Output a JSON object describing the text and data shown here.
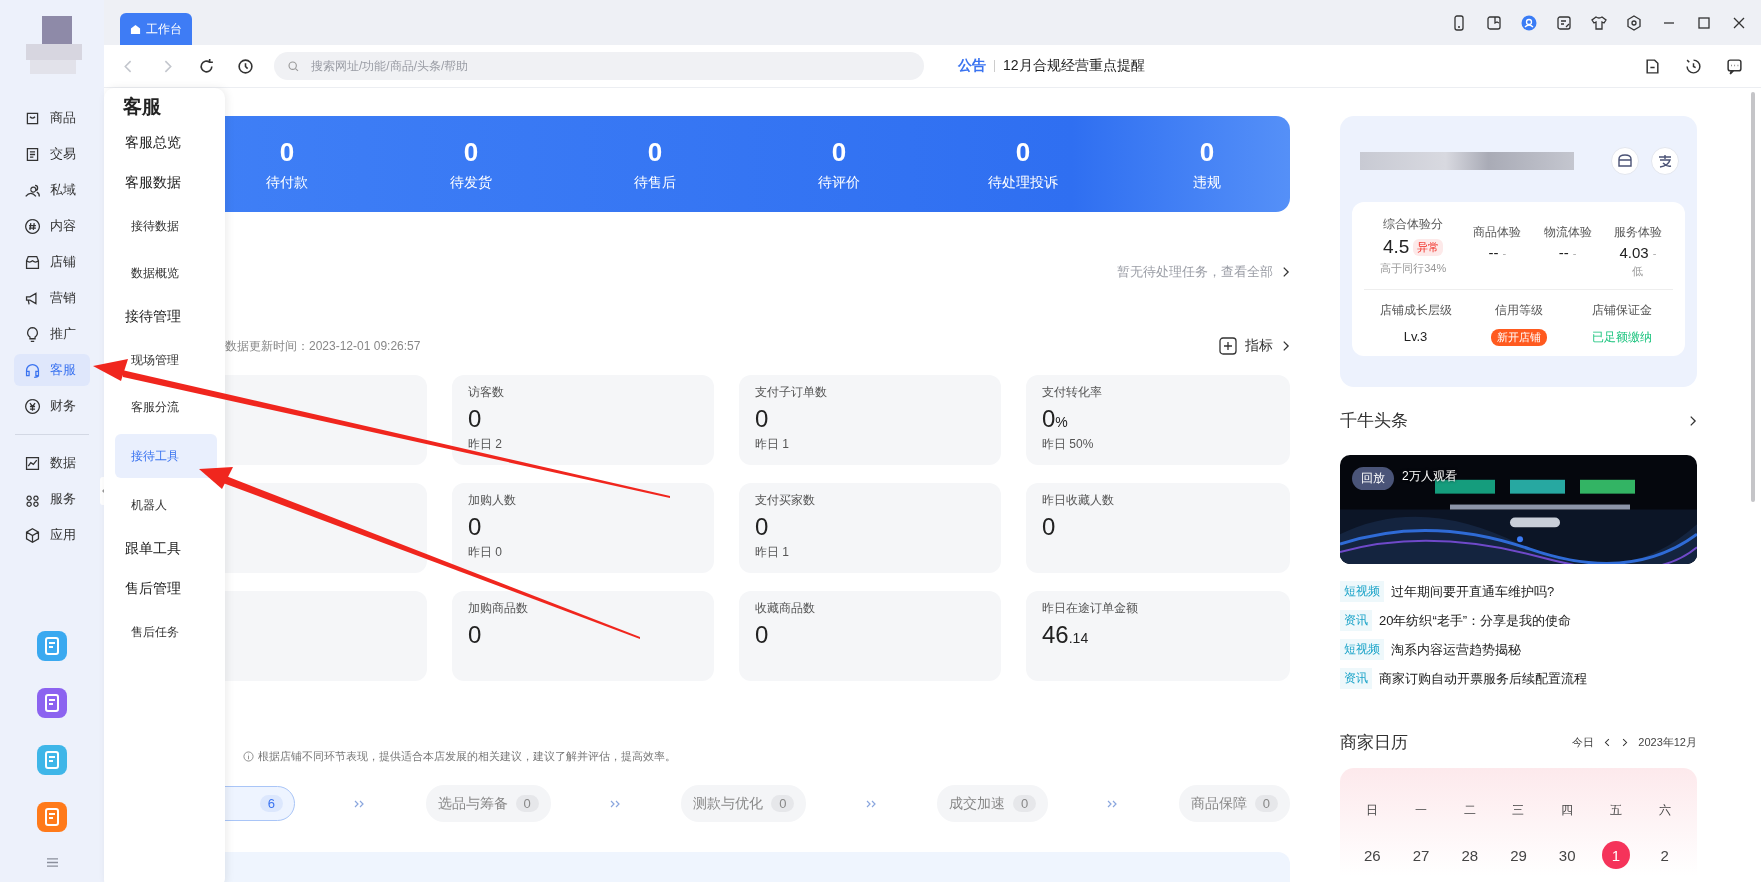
{
  "nav": [
    {
      "label": "商品",
      "selected": false
    },
    {
      "label": "交易",
      "selected": false
    },
    {
      "label": "私域",
      "selected": false
    },
    {
      "label": "内容",
      "selected": false
    },
    {
      "label": "店铺",
      "selected": false
    },
    {
      "label": "营销",
      "selected": false
    },
    {
      "label": "推广",
      "selected": false
    },
    {
      "label": "客服",
      "selected": true
    },
    {
      "label": "财务",
      "selected": false
    }
  ],
  "nav_extra": [
    {
      "label": "数据",
      "selected": false
    },
    {
      "label": "服务",
      "selected": false
    },
    {
      "label": "应用",
      "selected": false
    }
  ],
  "tab": {
    "label": "工作台",
    "selected": true
  },
  "search": {
    "placeholder": "搜索网址/功能/商品/头条/帮助"
  },
  "notice": {
    "tag": "公告",
    "text": "12月合规经营重点提醒"
  },
  "flyout": {
    "title": "客服",
    "items": [
      {
        "label": "客服总览",
        "selected": false
      },
      {
        "label": "客服数据",
        "selected": false,
        "children": [
          {
            "label": "接待数据",
            "selected": false
          },
          {
            "label": "数据概览",
            "selected": false
          }
        ]
      },
      {
        "label": "接待管理",
        "selected": false,
        "children": [
          {
            "label": "现场管理",
            "selected": false
          },
          {
            "label": "客服分流",
            "selected": false
          },
          {
            "label": "接待工具",
            "selected": true
          },
          {
            "label": "机器人",
            "selected": false
          }
        ]
      },
      {
        "label": "跟单工具",
        "selected": false
      },
      {
        "label": "售后管理",
        "selected": false,
        "children": [
          {
            "label": "售后任务",
            "selected": false
          }
        ]
      }
    ]
  },
  "order_stats": [
    {
      "value": "0",
      "label": "待付款"
    },
    {
      "value": "0",
      "label": "待发货"
    },
    {
      "value": "0",
      "label": "待售后"
    },
    {
      "value": "0",
      "label": "待评价"
    },
    {
      "value": "0",
      "label": "待处理投诉"
    },
    {
      "value": "0",
      "label": "违规"
    }
  ],
  "pending": "暂无待处理任务，查看全部",
  "data": {
    "updated": "数据更新时间：2023-12-01 09:26:57",
    "metrics_link": "指标",
    "rows": [
      [
        {
          "label": "访客数",
          "value": "0",
          "prev": "昨日 2"
        },
        {
          "label": "支付子订单数",
          "value": "0",
          "prev": "昨日 1"
        },
        {
          "label": "支付转化率",
          "value": "0",
          "unit": "%",
          "prev": "昨日 50%"
        }
      ],
      [
        {
          "label": "加购人数",
          "value": "0",
          "prev": "昨日 0"
        },
        {
          "label": "支付买家数",
          "value": "0",
          "prev": "昨日 1"
        },
        {
          "label": "昨日收藏人数",
          "value": "0"
        }
      ],
      [
        {
          "label": "加购商品数",
          "value": "0"
        },
        {
          "label": "收藏商品数",
          "value": "0"
        },
        {
          "label": "昨日在途订单金额",
          "value": "46",
          "unit": ".14"
        }
      ]
    ]
  },
  "advice": {
    "note": "根据店铺不同环节表现，提供适合本店发展的相关建议，建议了解并评估，提高效率。",
    "steps": [
      {
        "count": "6",
        "selected": true
      },
      {
        "label": "选品与筹备",
        "count": "0",
        "selected": false
      },
      {
        "label": "测款与优化",
        "count": "0",
        "selected": false
      },
      {
        "label": "成交加速",
        "count": "0",
        "selected": false
      },
      {
        "label": "商品保障",
        "count": "0",
        "selected": false
      }
    ]
  },
  "shop": {
    "scores": [
      {
        "label": "综合体验分",
        "value": "4.5",
        "badge": "异常",
        "note": "高于同行34%"
      },
      {
        "label": "商品体验",
        "value": "--",
        "trail": "-"
      },
      {
        "label": "物流体验",
        "value": "--",
        "trail": "-"
      },
      {
        "label": "服务体验",
        "value": "4.03",
        "trail": "-",
        "note": "低"
      }
    ],
    "status": [
      {
        "label": "店铺成长层级",
        "value": "Lv.3",
        "kind": "text"
      },
      {
        "label": "信用等级",
        "value": "新开店铺",
        "kind": "badge"
      },
      {
        "label": "店铺保证金",
        "value": "已足额缴纳",
        "kind": "good"
      }
    ]
  },
  "headlines": {
    "title": "千牛头条",
    "replay": "回放",
    "viewers": "2万人观看",
    "items": [
      {
        "tag": "短视频",
        "title": "过年期间要开直通车维护吗?"
      },
      {
        "tag": "资讯",
        "title": "20年纺织“老手”：分享是我的使命"
      },
      {
        "tag": "短视频",
        "title": "淘系内容运营趋势揭秘"
      },
      {
        "tag": "资讯",
        "title": "商家订购自动开票服务后续配置流程"
      }
    ]
  },
  "calendar": {
    "title": "商家日历",
    "today": "今日",
    "month": "2023年12月",
    "weekdays": [
      "日",
      "一",
      "二",
      "三",
      "四",
      "五",
      "六"
    ],
    "dates": [
      {
        "day": "26",
        "selected": false
      },
      {
        "day": "27",
        "selected": false
      },
      {
        "day": "28",
        "selected": false
      },
      {
        "day": "29",
        "selected": false
      },
      {
        "day": "30",
        "selected": false
      },
      {
        "day": "1",
        "selected": true
      },
      {
        "day": "2",
        "selected": false
      }
    ]
  }
}
